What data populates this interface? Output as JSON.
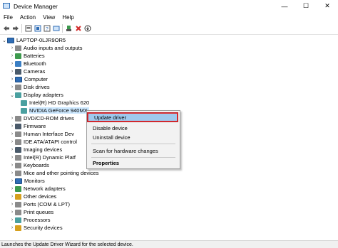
{
  "window": {
    "title": "Device Manager",
    "minimize": "—",
    "maximize": "☐",
    "close": "✕"
  },
  "menu": [
    "File",
    "Action",
    "View",
    "Help"
  ],
  "toolbar": {
    "icons": [
      "back-arrow",
      "forward-arrow",
      "properties-sheet",
      "show-hidden",
      "help",
      "scan-hardware",
      "update-driver",
      "uninstall-device",
      "disable-device"
    ]
  },
  "tree": {
    "root": "LAPTOP-0LJR9OR5",
    "items": [
      {
        "label": "Audio inputs and outputs",
        "expanded": false
      },
      {
        "label": "Batteries",
        "expanded": false
      },
      {
        "label": "Bluetooth",
        "expanded": false
      },
      {
        "label": "Cameras",
        "expanded": false
      },
      {
        "label": "Computer",
        "expanded": false
      },
      {
        "label": "Disk drives",
        "expanded": false
      },
      {
        "label": "Display adapters",
        "expanded": true
      },
      {
        "label": "Intel(R) HD Graphics 620",
        "child": true
      },
      {
        "label": "NVIDIA GeForce 940MX",
        "child": true,
        "selected": true
      },
      {
        "label": "DVD/CD-ROM drives",
        "expanded": false
      },
      {
        "label": "Firmware",
        "expanded": false
      },
      {
        "label": "Human Interface Dev",
        "expanded": false
      },
      {
        "label": "IDE ATA/ATAPI control",
        "expanded": false
      },
      {
        "label": "Imaging devices",
        "expanded": false
      },
      {
        "label": "Intel(R) Dynamic Platf",
        "expanded": false
      },
      {
        "label": "Keyboards",
        "expanded": false
      },
      {
        "label": "Mice and other pointing devices",
        "expanded": false
      },
      {
        "label": "Monitors",
        "expanded": false
      },
      {
        "label": "Network adapters",
        "expanded": false
      },
      {
        "label": "Other devices",
        "expanded": false
      },
      {
        "label": "Ports (COM & LPT)",
        "expanded": false
      },
      {
        "label": "Print queues",
        "expanded": false
      },
      {
        "label": "Processors",
        "expanded": false
      },
      {
        "label": "Security devices",
        "expanded": false
      }
    ]
  },
  "context_menu": {
    "items": [
      "Update driver",
      "Disable device",
      "Uninstall device",
      "Scan for hardware changes",
      "Properties"
    ],
    "highlighted": "Update driver"
  },
  "status": "Launches the Update Driver Wizard for the selected device."
}
